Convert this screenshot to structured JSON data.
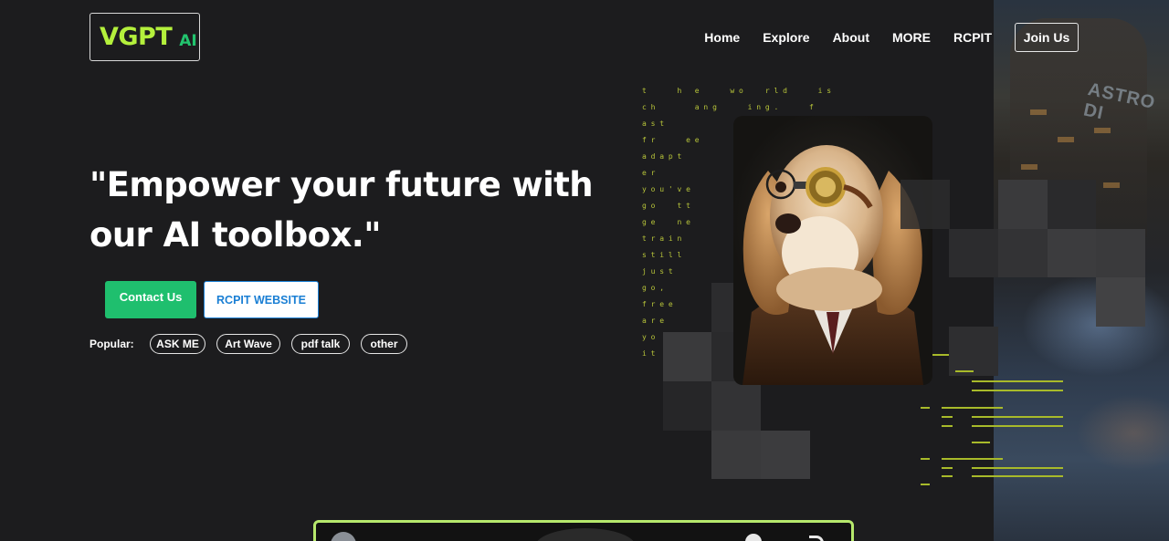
{
  "logo": {
    "main": "VGPT",
    "sub": "AI"
  },
  "nav": {
    "items": [
      "Home",
      "Explore",
      "About",
      "MORE",
      "RCPIT"
    ],
    "join_label": "Join Us"
  },
  "hero": {
    "title_line1": "\"Empower your future with",
    "title_line2": "our AI toolbox.\""
  },
  "buttons": {
    "contact": "Contact Us",
    "rcpit": "RCPIT WEBSITE"
  },
  "popular": {
    "label": "Popular:",
    "chips": [
      "ASK ME",
      "Art Wave",
      "pdf talk",
      "other"
    ]
  },
  "matrix": [
    "t       h   e       w o     r l d       i s",
    "c h         a n g       i n g .       f",
    "a s t",
    "f r       e e",
    "a d a p t",
    "e r",
    "y o u ' v e",
    "g o     t t",
    "g e     n e",
    "t r a i n",
    "s t i l l",
    "j u s t",
    "g o ,",
    "f r e e",
    "a r e",
    "y o   n",
    "i t   l"
  ],
  "side_photo": {
    "sign_text": "ASTRO DI"
  },
  "colors": {
    "background": "#1c1c1e",
    "logo_main": "#b4f03c",
    "logo_sub": "#22c46e",
    "contact_button": "#1fbf6e",
    "rcpit_button_text": "#1a7fd4",
    "matrix_text": "#b7c43a",
    "video_border": "#b6e86c"
  }
}
